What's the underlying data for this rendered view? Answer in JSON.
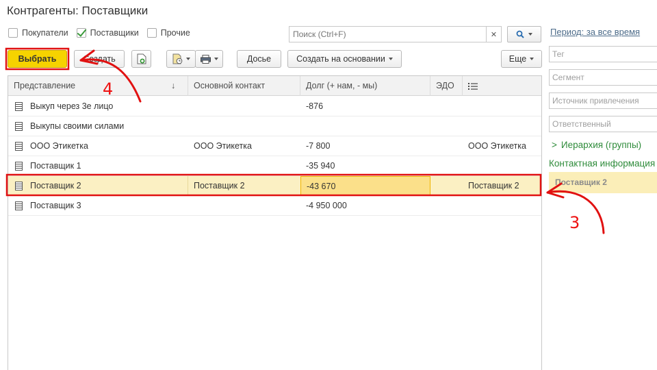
{
  "window": {
    "title": "Контрагенты: Поставщики"
  },
  "filters": [
    {
      "label": "Покупатели",
      "checked": false
    },
    {
      "label": "Поставщики",
      "checked": true
    },
    {
      "label": "Прочие",
      "checked": false
    }
  ],
  "search": {
    "placeholder": "Поиск (Ctrl+F)",
    "value": ""
  },
  "toolbar": {
    "select_label": "Выбрать",
    "create_label": "Создать",
    "dossier_label": "Досье",
    "create_based_label": "Создать на основании",
    "more_label": "Еще"
  },
  "table": {
    "columns": [
      "Представление",
      "Основной контакт",
      "Долг (+ нам, - мы)",
      "ЭДО"
    ],
    "rows": [
      {
        "name": "Выкуп через 3е лицо",
        "contact": "",
        "debt": "-876",
        "edo": "",
        "extra": ""
      },
      {
        "name": "Выкупы своими силами",
        "contact": "",
        "debt": "",
        "edo": "",
        "extra": ""
      },
      {
        "name": "ООО Этикетка",
        "contact": "ООО Этикетка",
        "debt": "-7 800",
        "edo": "",
        "extra": "ООО Этикетка"
      },
      {
        "name": "Поставщик 1",
        "contact": "",
        "debt": "-35 940",
        "edo": "",
        "extra": ""
      },
      {
        "name": "Поставщик 2",
        "contact": "Поставщик 2",
        "debt": "-43 670",
        "edo": "",
        "extra": "Поставщик 2",
        "selected": true
      },
      {
        "name": "Поставщик 3",
        "contact": "",
        "debt": "-4 950 000",
        "edo": "",
        "extra": ""
      }
    ]
  },
  "side_panel": {
    "period_link": "Период: за все время",
    "fields": [
      {
        "placeholder": "Тег"
      },
      {
        "placeholder": "Сегмент"
      },
      {
        "placeholder": "Источник привлечения"
      },
      {
        "placeholder": "Ответственный"
      }
    ],
    "hierarchy_link": "Иерархия (группы)",
    "contact_info_title": "Контактная информация",
    "contact_info_value": "Поставщик 2"
  },
  "annotations": {
    "step_4": "4",
    "step_3": "3"
  },
  "colors": {
    "accent_yellow": "#f6d300",
    "selection": "#fbf0c3",
    "annotation_red": "#e11111",
    "link_green": "#2e8b3a"
  }
}
